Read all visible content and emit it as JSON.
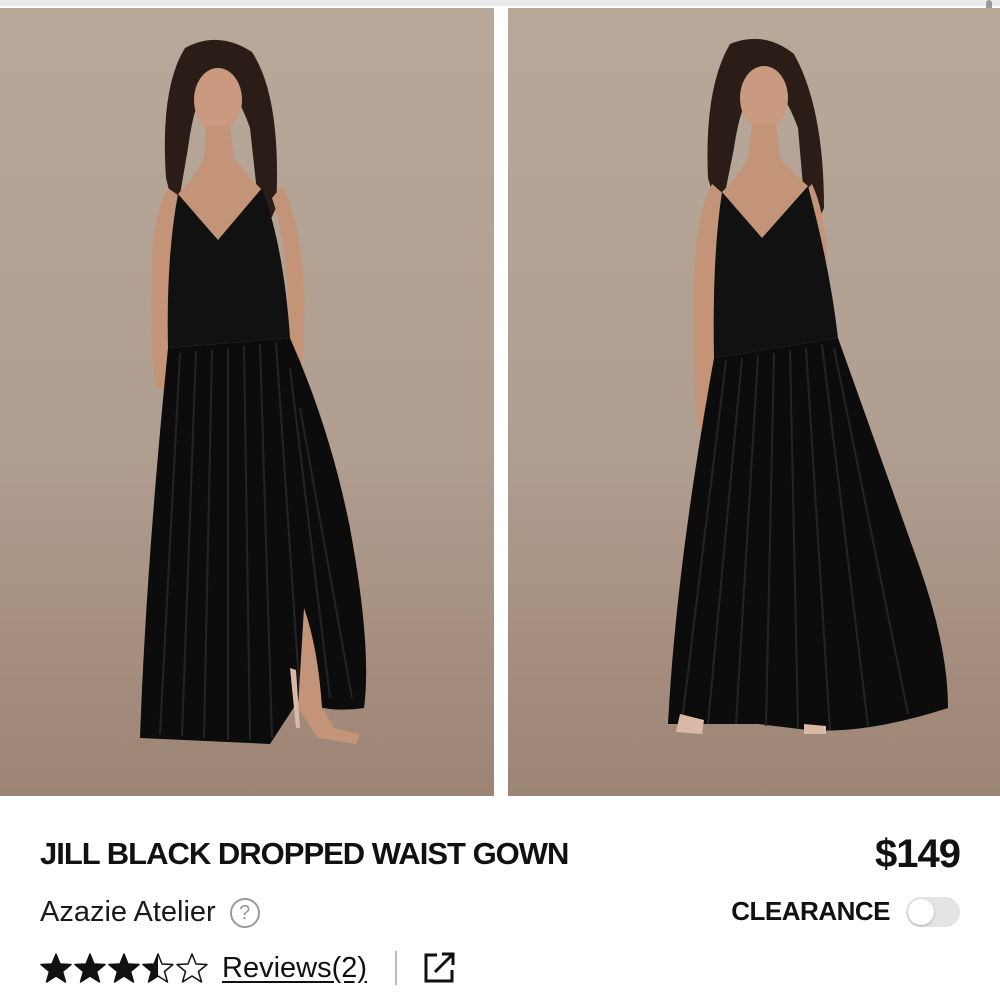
{
  "product": {
    "title": "JILL BLACK DROPPED WAIST GOWN",
    "price": "$149",
    "brand": "Azazie Atelier",
    "clearance_label": "CLEARANCE",
    "clearance_enabled": false,
    "rating": 3.5,
    "rating_max": 5,
    "reviews_label": "Reviews(2)"
  },
  "icons": {
    "help": "help-icon",
    "share": "share-icon",
    "star": "star-icon"
  },
  "colors": {
    "background": "#ffffff",
    "photo_backdrop": "#b09f91",
    "dress": "#0d0d0d",
    "text": "#111111",
    "muted": "#9a9a9a"
  }
}
